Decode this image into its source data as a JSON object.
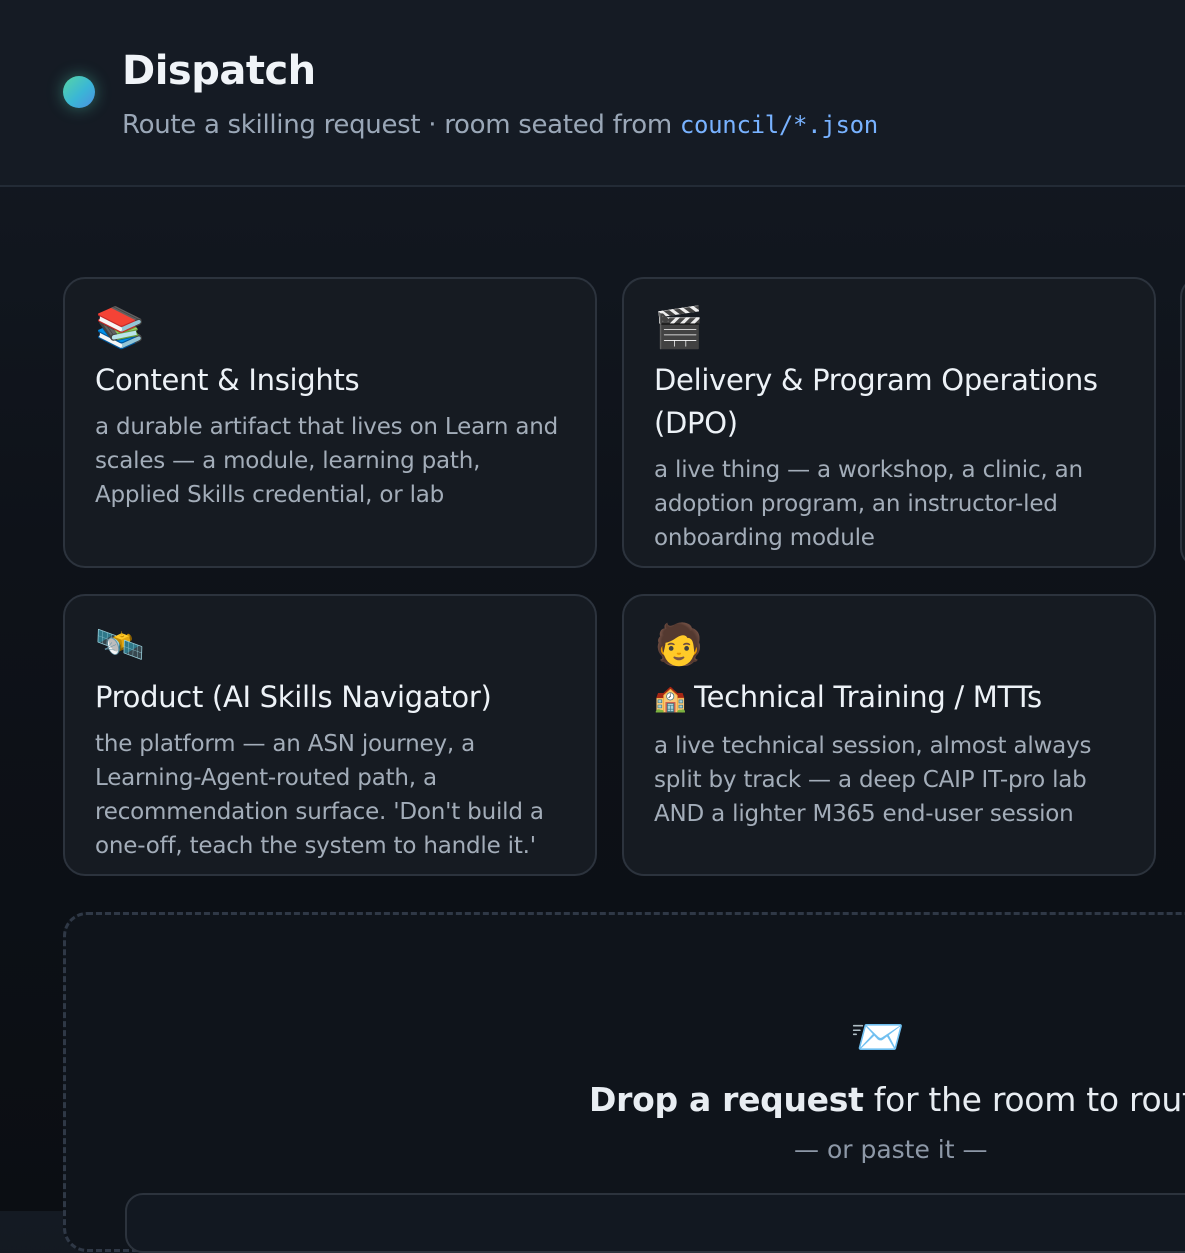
{
  "header": {
    "title": "Dispatch",
    "subtitle_prefix": "Route a skilling request · room seated from ",
    "subtitle_code": "council/*.json"
  },
  "cards": [
    {
      "icon": "📚",
      "icon_name": "books-icon",
      "title": "Content & Insights",
      "description": "a durable artifact that lives on Learn and scales — a module, learning path, Applied Skills credential, or lab"
    },
    {
      "icon": "🎬",
      "icon_name": "clapperboard-icon",
      "title": "Delivery & Program Operations (DPO)",
      "description": "a live thing — a workshop, a clinic, an adoption program, an instructor-led onboarding module"
    },
    {
      "icon": "🛰️",
      "icon_name": "satellite-icon",
      "title": "Product (AI Skills Navigator)",
      "description": "the platform — an ASN journey, a Learning-Agent-routed path, a recommendation surface. 'Don't build a one-off, teach the system to handle it.'"
    },
    {
      "icon": "🧑",
      "icon_name": "person-icon",
      "title_icon": "🏫",
      "title_icon_name": "school-icon",
      "title": "Technical Training / MTTs",
      "description": "a live technical session, almost always split by track — a deep CAIP IT-pro lab AND a lighter M365 end-user session"
    }
  ],
  "dropzone": {
    "icon": "📨",
    "icon_name": "incoming-envelope-icon",
    "title_bold": "Drop a request",
    "title_rest": " for the room to route",
    "or_text": "— or paste it —"
  }
}
